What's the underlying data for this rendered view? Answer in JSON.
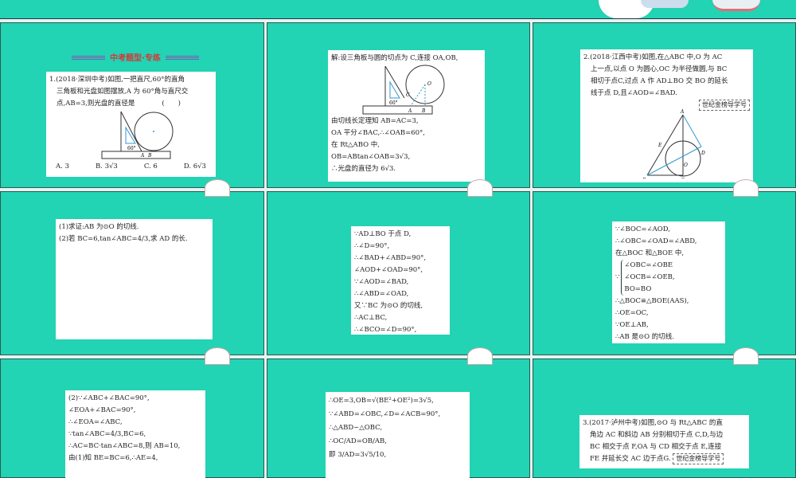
{
  "header": {
    "section_title": "中考题型·专练"
  },
  "p1": {
    "lines": [
      "1.(2018·深圳中考)如图,一把直尺,60°的直角",
      "三角板和光盘如图摆放,A 为 60°角与直尺交",
      "点,AB=3,则光盘的直径是　　　　(　　)"
    ],
    "fig": {
      "angle": "60°",
      "a": "A",
      "b": "B"
    },
    "choices": [
      "A. 3",
      "B. 3√3",
      "C. 6",
      "D. 6√3"
    ]
  },
  "p2": {
    "lines0": "解:设三角板与圆的切点为 C,连接 OA,OB,",
    "fig": {
      "angle": "60°",
      "a": "A",
      "b": "B",
      "c": "C",
      "o": "O"
    },
    "lines": [
      "由切线长定理知 AB=AC=3,",
      "OA 平分∠BAC,∴∠OAB=60°,",
      "在 Rt△ABO 中,",
      "OB=ABtan∠OAB=3√3,",
      "∴光盘的直径为 6√3."
    ]
  },
  "p3": {
    "lines": [
      "2.(2018·江西中考)如图,在△ABC 中,O 为 AC",
      "上一点,以点 O 为圆心,OC 为半径做圆,与 BC",
      "相切于点C,过点 A 作 AD⊥BO 交 BO 的延长",
      "线于点 D,且∠AOD=∠BAD."
    ],
    "tag": "世纪金榜导学号",
    "fig": {
      "a": "A",
      "b": "B",
      "c": "C",
      "d": "D",
      "e": "E",
      "o": "O"
    }
  },
  "p4": {
    "lines": [
      "(1)求证:AB 为⊙O 的切线.",
      "(2)若 BC=6,tan∠ABC=4/3,求 AD 的长."
    ]
  },
  "p5": {
    "lines": [
      "∵AD⊥BO 于点 D,",
      "∴∠D=90°,",
      "∴∠BAD+∠ABD=90°,",
      "∠AOD+∠OAD=90°,",
      "∵∠AOD=∠BAD,",
      "∴∠ABD=∠OAD,",
      "又∵BC 为⊙O 的切线,",
      "∴AC⊥BC,",
      "∴∠BCO=∠D=90°,"
    ]
  },
  "p6": {
    "lines": [
      "∵∠BOC=∠AOD,",
      "∴∠OBC=∠OAD=∠ABD,",
      "在△BOC 和△BOE 中,",
      "∠OBC=∠OBE",
      "∠OCB=∠OEB,",
      "BO=BO",
      "∴△BOC≌△BOE(AAS),",
      "∴OE=OC,",
      "∵OE⊥AB,",
      "∴AB 是⊙O 的切线."
    ],
    "brace": "∵"
  },
  "p7": {
    "lines": [
      "(2)∵∠ABC+∠BAC=90°,",
      "∠EOA+∠BAC=90°,",
      "∴∠EOA=∠ABC,",
      "∵tan∠ABC=4/3,BC=6,",
      "∴AC=BC·tan∠ABC=8,则 AB=10,",
      "由(1)知 BE=BC=6,∴AE=4,"
    ]
  },
  "p8": {
    "lines": [
      "∴OE=3,OB=√(BE²+OE²)=3√5,",
      "∵∠ABD=∠OBC,∠D=∠ACB=90°,",
      "∴△ABD∽△OBC,",
      "∴OC/AD=OB/AB,",
      "即 3/AD=3√5/10,"
    ]
  },
  "p9": {
    "lines": [
      "3.(2017·泸州中考)如图,⊙O 与 Rt△ABC 的直",
      "角边 AC 和斜边 AB 分别相切于点 C,D,与边",
      "BC 相交于点 F,OA 与 CD 相交于点 E,连接",
      "FE 并延长交 AC 边于点G."
    ],
    "tag": "世纪金榜导学号"
  }
}
